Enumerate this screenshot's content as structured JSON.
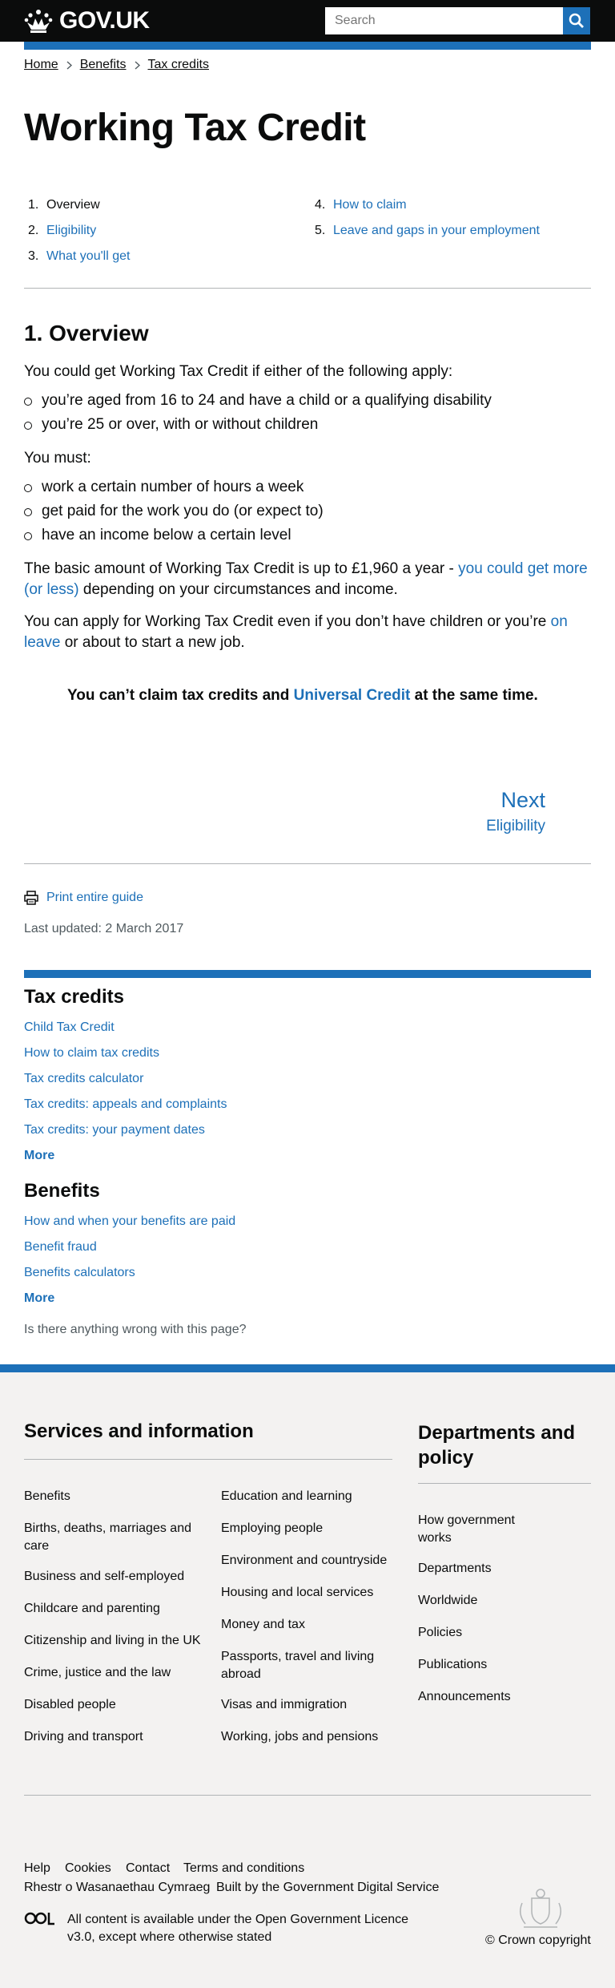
{
  "header": {
    "logo_text": "GOV.UK",
    "search_placeholder": "Search",
    "brand_color": "#1d70b8"
  },
  "breadcrumb": [
    "Home",
    "Benefits",
    "Tax credits"
  ],
  "page_title": "Working Tax Credit",
  "contents": [
    {
      "num": "1.",
      "label": "Overview",
      "current": true
    },
    {
      "num": "2.",
      "label": "Eligibility",
      "current": false
    },
    {
      "num": "3.",
      "label": "What you'll get",
      "current": false
    },
    {
      "num": "4.",
      "label": "How to claim",
      "current": false
    },
    {
      "num": "5.",
      "label": "Leave and gaps in your employment",
      "current": false
    }
  ],
  "section": {
    "title": "1. Overview",
    "intro": "You could get Working Tax Credit if either of the following apply:",
    "bullets1": [
      "you’re aged from 16 to 24 and have a child or a qualifying disability",
      "you’re 25 or over, with or without children"
    ],
    "must": "You must:",
    "bullets2": [
      "work a certain number of hours a week",
      "get paid for the work you do (or expect to)",
      "have an income below a certain level"
    ],
    "basic_pre": "The basic amount of Working Tax Credit is up to £1,960 a year - ",
    "basic_link": "you could get more (or less)",
    "basic_post": " depending on your circumstances and income.",
    "apply_pre": "You can apply for Working Tax Credit even if you don’t have children or you’re ",
    "apply_link": "on leave",
    "apply_post": " or about to start a new job.",
    "callout_pre": "You can’t claim tax credits and ",
    "callout_link": "Universal Credit",
    "callout_post": " at the same time."
  },
  "next": {
    "label": "Next",
    "link": "Eligibility"
  },
  "print_label": "Print entire guide",
  "last_updated": "Last updated: 2 March 2017",
  "related": [
    {
      "heading": "Tax credits",
      "links": [
        "Child Tax Credit",
        "How to claim tax credits",
        "Tax credits calculator",
        "Tax credits: appeals and complaints",
        "Tax credits: your payment dates"
      ],
      "more": "More"
    },
    {
      "heading": "Benefits",
      "links": [
        "How and when your benefits are paid",
        "Benefit fraud",
        "Benefits calculators"
      ],
      "more": "More"
    }
  ],
  "feedback": "Is there anything wrong with this page?",
  "footer": {
    "services_heading": "Services and information",
    "services_col1": [
      "Benefits",
      "Births, deaths, marriages and care",
      "Business and self-employed",
      "Childcare and parenting",
      "Citizenship and living in the UK",
      "Crime, justice and the law",
      "Disabled people",
      "Driving and transport"
    ],
    "services_col2": [
      "Education and learning",
      "Employing people",
      "Environment and countryside",
      "Housing and local services",
      "Money and tax",
      "Passports, travel and living abroad",
      "Visas and immigration",
      "Working, jobs and pensions"
    ],
    "departments_heading": "Departments and policy",
    "departments": [
      "How government works",
      "Departments",
      "Worldwide",
      "Policies",
      "Publications",
      "Announcements"
    ],
    "meta_links": [
      "Help",
      "Cookies",
      "Contact",
      "Terms and conditions"
    ],
    "welsh": "Rhestr o Wasanaethau Cymraeg",
    "built_by_pre": "Built by the ",
    "built_by_link": "Government Digital Service",
    "licence_pre": "All content is available under the ",
    "licence_link": "Open Government Licence v3.0",
    "licence_post": ", except where otherwise stated",
    "copyright": "© Crown copyright"
  }
}
